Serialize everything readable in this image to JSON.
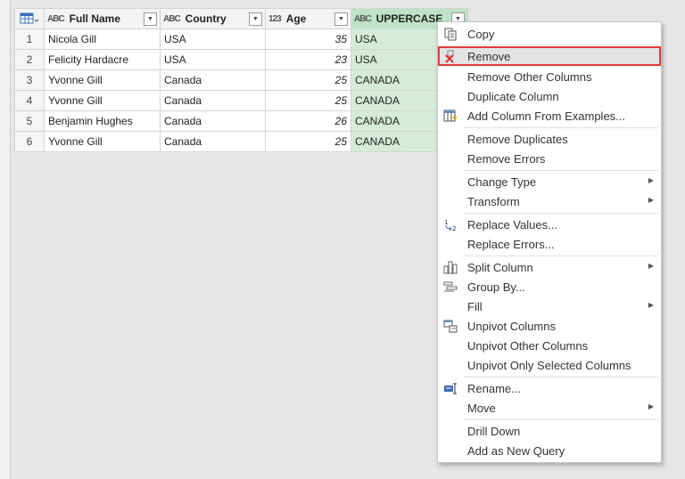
{
  "table": {
    "columns": [
      {
        "type_icon": "ABC",
        "name": "Full Name"
      },
      {
        "type_icon": "ABC",
        "name": "Country"
      },
      {
        "type_icon": "123",
        "name": "Age"
      },
      {
        "type_icon": "ABC",
        "name": "UPPERCASE"
      }
    ],
    "rows": [
      {
        "n": "1",
        "name": "Nicola Gill",
        "country": "USA",
        "age": "35",
        "upper": "USA"
      },
      {
        "n": "2",
        "name": "Felicity Hardacre",
        "country": "USA",
        "age": "23",
        "upper": "USA"
      },
      {
        "n": "3",
        "name": "Yvonne Gill",
        "country": "Canada",
        "age": "25",
        "upper": "CANADA"
      },
      {
        "n": "4",
        "name": "Yvonne Gill",
        "country": "Canada",
        "age": "25",
        "upper": "CANADA"
      },
      {
        "n": "5",
        "name": "Benjamin Hughes",
        "country": "Canada",
        "age": "26",
        "upper": "CANADA"
      },
      {
        "n": "6",
        "name": "Yvonne Gill",
        "country": "Canada",
        "age": "25",
        "upper": "CANADA"
      }
    ]
  },
  "menu": {
    "items": [
      {
        "label": "Copy",
        "icon": "copy-icon"
      },
      {
        "label": "Remove",
        "icon": "remove-icon"
      },
      {
        "label": "Remove Other Columns"
      },
      {
        "label": "Duplicate Column"
      },
      {
        "label": "Add Column From Examples...",
        "icon": "add-column-examples-icon"
      },
      {
        "label": "Remove Duplicates"
      },
      {
        "label": "Remove Errors"
      },
      {
        "label": "Change Type"
      },
      {
        "label": "Transform"
      },
      {
        "label": "Replace Values...",
        "icon": "replace-values-icon"
      },
      {
        "label": "Replace Errors..."
      },
      {
        "label": "Split Column",
        "icon": "split-column-icon"
      },
      {
        "label": "Group By...",
        "icon": "group-by-icon"
      },
      {
        "label": "Fill"
      },
      {
        "label": "Unpivot Columns",
        "icon": "unpivot-icon"
      },
      {
        "label": "Unpivot Other Columns"
      },
      {
        "label": "Unpivot Only Selected Columns"
      },
      {
        "label": "Rename...",
        "icon": "rename-icon"
      },
      {
        "label": "Move"
      },
      {
        "label": "Drill Down"
      },
      {
        "label": "Add as New Query"
      }
    ],
    "highlighted": "Remove"
  },
  "colors": {
    "selected_column_header": "#bfe3c7",
    "selected_column_cells": "#d4ecd9",
    "highlight_outline": "#e0393e",
    "remove_icon_red": "#d9302f"
  }
}
